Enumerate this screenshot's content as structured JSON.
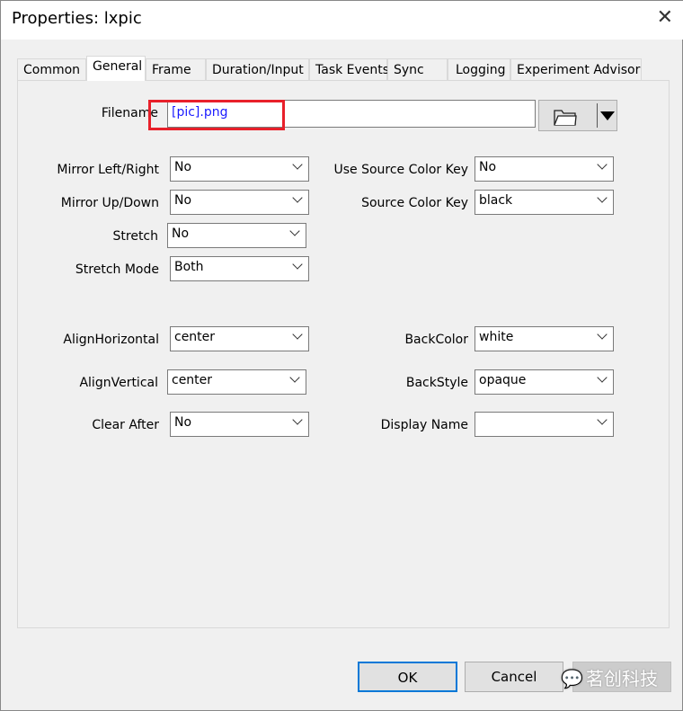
{
  "window": {
    "title": "Properties: lxpic"
  },
  "tabs": [
    "Common",
    "General",
    "Frame",
    "Duration/Input",
    "Task Events",
    "Sync",
    "Logging",
    "Experiment Advisor"
  ],
  "active_tab": "General",
  "filename": {
    "label": "Filename",
    "value": "[pic].png"
  },
  "left": [
    {
      "label": "Mirror Left/Right",
      "value": "No"
    },
    {
      "label": "Mirror Up/Down",
      "value": "No"
    },
    {
      "label": "Stretch",
      "value": "No"
    },
    {
      "label": "Stretch Mode",
      "value": "Both"
    },
    {
      "label": "AlignHorizontal",
      "value": "center"
    },
    {
      "label": "AlignVertical",
      "value": "center"
    },
    {
      "label": "Clear After",
      "value": "No"
    }
  ],
  "right": [
    {
      "label": "Use Source Color Key",
      "value": "No"
    },
    {
      "label": "Source Color Key",
      "value": "black"
    },
    {
      "label": "BackColor",
      "value": "white"
    },
    {
      "label": "BackStyle",
      "value": "opaque"
    },
    {
      "label": "Display Name",
      "value": ""
    }
  ],
  "buttons": {
    "ok": "OK",
    "cancel": "Cancel"
  },
  "watermark": "茗创科技",
  "highlight_color": "#e8202a"
}
